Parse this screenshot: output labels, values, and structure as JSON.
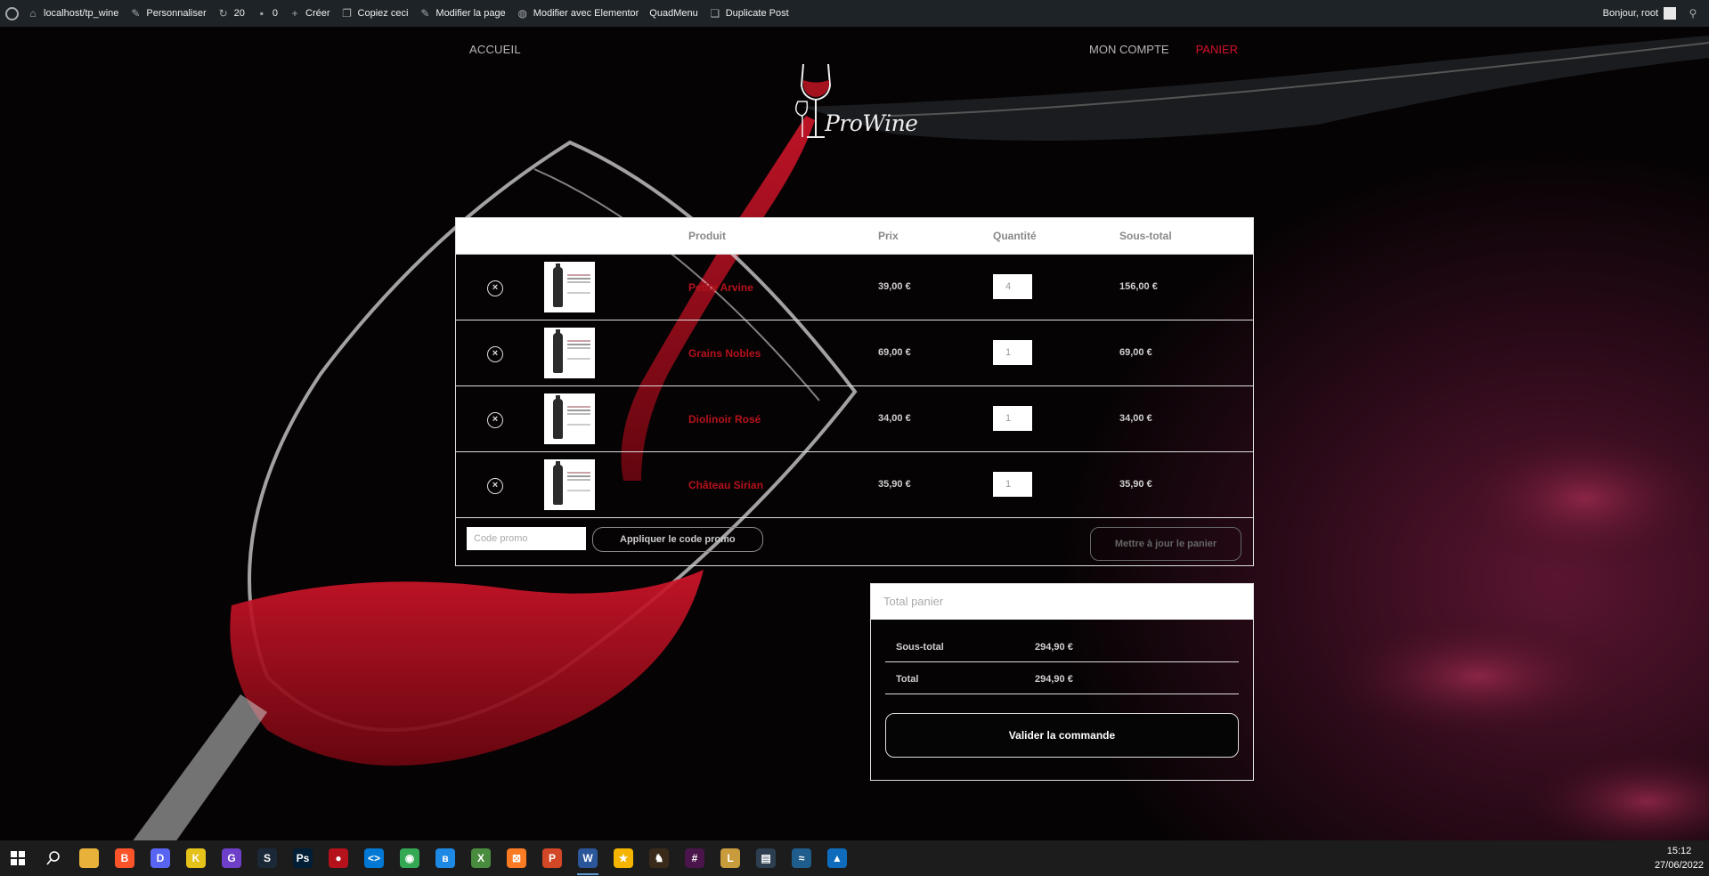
{
  "admin_bar": {
    "site": "localhost/tp_wine",
    "customize": "Personnaliser",
    "updates": "20",
    "comments": "0",
    "new": "Créer",
    "copy": "Copiez ceci",
    "edit_page": "Modifier la page",
    "edit_elementor": "Modifier avec Elementor",
    "quadmenu": "QuadMenu",
    "duplicate": "Duplicate Post",
    "greeting": "Bonjour, root"
  },
  "nav": {
    "home": "ACCUEIL",
    "account": "MON COMPTE",
    "cart": "PANIER"
  },
  "logo": {
    "text": "ProWine"
  },
  "cart": {
    "headers": {
      "product": "Produit",
      "price": "Prix",
      "quantity": "Quantité",
      "subtotal": "Sous-total"
    },
    "items": [
      {
        "name": "Petite Arvine",
        "price": "39,00 €",
        "qty": "4",
        "subtotal": "156,00 €"
      },
      {
        "name": "Grains Nobles",
        "price": "69,00 €",
        "qty": "1",
        "subtotal": "69,00 €"
      },
      {
        "name": "Diolinoir Rosé",
        "price": "34,00 €",
        "qty": "1",
        "subtotal": "34,00 €"
      },
      {
        "name": "Château Sirian",
        "price": "35,90 €",
        "qty": "1",
        "subtotal": "35,90 €"
      }
    ],
    "coupon_placeholder": "Code promo",
    "apply_label": "Appliquer le code promo",
    "update_label": "Mettre à jour le panier"
  },
  "totals": {
    "title": "Total panier",
    "subtotal_label": "Sous-total",
    "subtotal_value": "294,90 €",
    "total_label": "Total",
    "total_value": "294,90 €",
    "checkout_label": "Valider la commande"
  },
  "taskbar": {
    "time": "15:12",
    "date": "27/06/2022",
    "apps": [
      {
        "name": "file-explorer-icon",
        "color": "#e8b23a",
        "glyph": ""
      },
      {
        "name": "brave-icon",
        "color": "#fb542b",
        "glyph": "B"
      },
      {
        "name": "discord-icon",
        "color": "#5865f2",
        "glyph": "D"
      },
      {
        "name": "gitkraken-icon",
        "color": "#e5c21a",
        "glyph": "K"
      },
      {
        "name": "github-icon",
        "color": "#6e40c9",
        "glyph": "G"
      },
      {
        "name": "steam-icon",
        "color": "#1b2838",
        "glyph": "S"
      },
      {
        "name": "photoshop-icon",
        "color": "#001e36",
        "glyph": "Ps"
      },
      {
        "name": "beekeeper-icon",
        "color": "#b5121b",
        "glyph": "●"
      },
      {
        "name": "vscode-icon",
        "color": "#0078d4",
        "glyph": "<>"
      },
      {
        "name": "chrome-icon",
        "color": "#34a853",
        "glyph": "◉"
      },
      {
        "name": "bluetooth-icon",
        "color": "#1e88e5",
        "glyph": "ʙ"
      },
      {
        "name": "xampp-icon",
        "color": "#4a8c3f",
        "glyph": "X"
      },
      {
        "name": "xampp-control-icon",
        "color": "#fb7a24",
        "glyph": "⊠"
      },
      {
        "name": "powerpoint-icon",
        "color": "#d24726",
        "glyph": "P"
      },
      {
        "name": "word-icon",
        "color": "#2b579a",
        "glyph": "W"
      },
      {
        "name": "star-app-icon",
        "color": "#f4b400",
        "glyph": "★"
      },
      {
        "name": "game-icon",
        "color": "#3a2a1a",
        "glyph": "♞"
      },
      {
        "name": "slack-icon",
        "color": "#4a154b",
        "glyph": "#"
      },
      {
        "name": "league-icon",
        "color": "#c89b3c",
        "glyph": "L"
      },
      {
        "name": "terminal-icon",
        "color": "#2c3e50",
        "glyph": "▤"
      },
      {
        "name": "mysql-workbench-icon",
        "color": "#1f5d8c",
        "glyph": "≈"
      },
      {
        "name": "photos-icon",
        "color": "#0f6cbd",
        "glyph": "▲"
      }
    ]
  }
}
